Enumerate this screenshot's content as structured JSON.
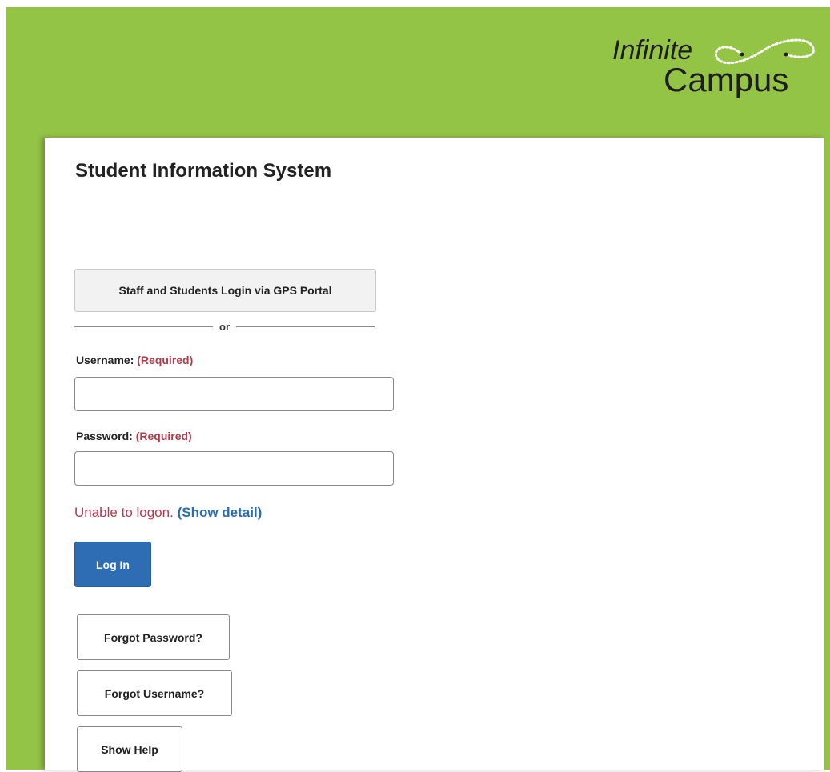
{
  "brand": {
    "logo_line1": "Infinite",
    "logo_line2": "Campus",
    "green": "#94c446"
  },
  "page": {
    "title": "Student Information System"
  },
  "sso": {
    "button_label": "Staff and Students Login via GPS Portal",
    "divider_text": "or"
  },
  "form": {
    "username_label": "Username:",
    "username_required": "(Required)",
    "username_value": "",
    "password_label": "Password:",
    "password_required": "(Required)",
    "password_value": ""
  },
  "error": {
    "message": "Unable to logon.",
    "detail_link": "(Show detail)",
    "color": "#b53a4c"
  },
  "actions": {
    "login_label": "Log In",
    "forgot_password_label": "Forgot Password?",
    "forgot_username_label": "Forgot Username?",
    "show_help_label": "Show Help",
    "primary_color": "#2e6db4"
  }
}
